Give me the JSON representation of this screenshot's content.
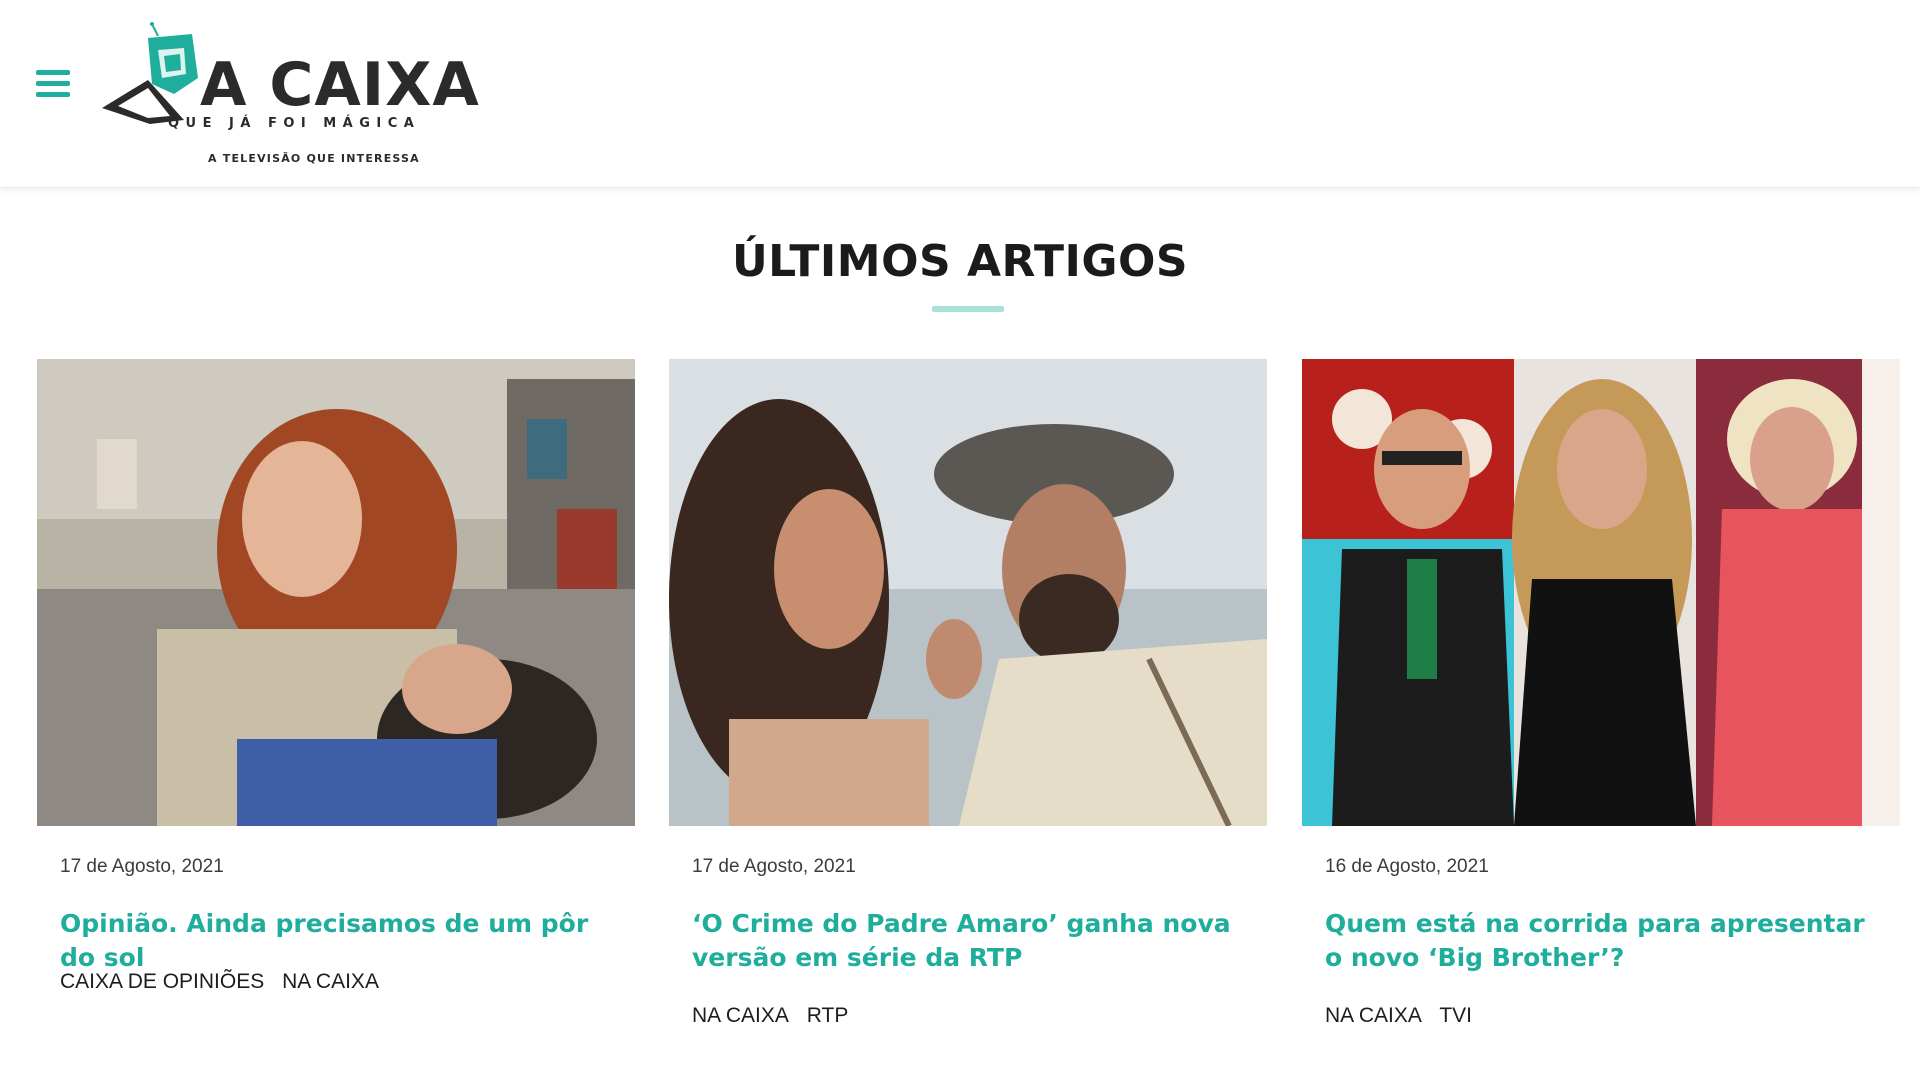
{
  "header": {
    "menu_icon": "hamburger-menu-icon",
    "logo": {
      "wordmark": "A CAIXA",
      "subtitle": "QUE JÁ FOI MÁGICA",
      "tagline": "A TELEVISÃO QUE INTERESSA"
    }
  },
  "section": {
    "title": "ÚLTIMOS ARTIGOS"
  },
  "articles": [
    {
      "date": "17 de Agosto, 2021",
      "title": "Opinião. Ainda precisamos de um pôr do sol",
      "tags": [
        "CAIXA DE OPINIÕES",
        "NA CAIXA"
      ]
    },
    {
      "date": "17 de Agosto, 2021",
      "title": "‘O Crime do Padre Amaro’ ganha nova versão em série da RTP",
      "tags": [
        "NA CAIXA",
        "RTP"
      ]
    },
    {
      "date": "16 de Agosto, 2021",
      "title": "Quem está na corrida para apresentar o novo ‘Big Brother’?",
      "tags": [
        "NA CAIXA",
        "TVI"
      ]
    }
  ],
  "colors": {
    "accent": "#1fae9b",
    "accent_light": "#a8e0da",
    "text": "#1d1d1d"
  }
}
